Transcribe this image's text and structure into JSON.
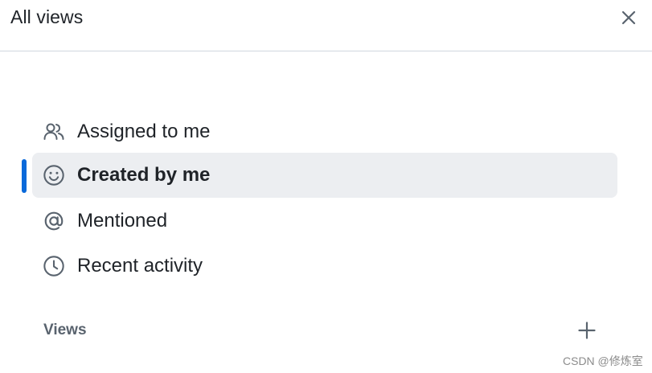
{
  "header": {
    "title": "All views",
    "close_icon": "close-icon"
  },
  "nav": {
    "items": [
      {
        "label": "Assigned to me",
        "icon": "people-icon",
        "selected": false
      },
      {
        "label": "Created by me",
        "icon": "smiley-icon",
        "selected": true
      },
      {
        "label": "Mentioned",
        "icon": "mention-icon",
        "selected": false
      },
      {
        "label": "Recent activity",
        "icon": "clock-icon",
        "selected": false
      }
    ]
  },
  "views_section": {
    "label": "Views",
    "add_icon": "plus-icon"
  },
  "watermark": "CSDN @修炼室",
  "colors": {
    "accent": "#0969da",
    "selected_bg": "#eceef1",
    "text": "#1f2328",
    "muted": "#59636e",
    "icon": "#59636e",
    "divider": "#d0d7de"
  }
}
